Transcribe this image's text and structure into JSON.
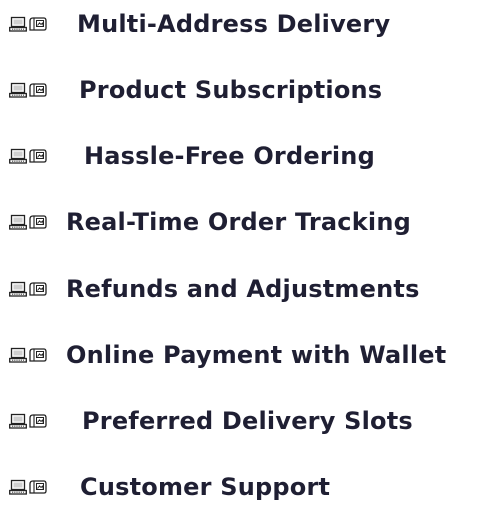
{
  "features": {
    "items": [
      {
        "label": "Multi-Address Delivery",
        "icon": "computer-icon"
      },
      {
        "label": "Product Subscriptions",
        "icon": "computer-icon"
      },
      {
        "label": "Hassle-Free Ordering",
        "icon": "computer-icon"
      },
      {
        "label": "Real-Time Order Tracking",
        "icon": "computer-icon"
      },
      {
        "label": "Refunds and Adjustments",
        "icon": "computer-icon"
      },
      {
        "label": "Online Payment with Wallet",
        "icon": "computer-icon"
      },
      {
        "label": "Preferred Delivery Slots",
        "icon": "computer-icon"
      },
      {
        "label": "Customer Support",
        "icon": "computer-icon"
      }
    ]
  }
}
